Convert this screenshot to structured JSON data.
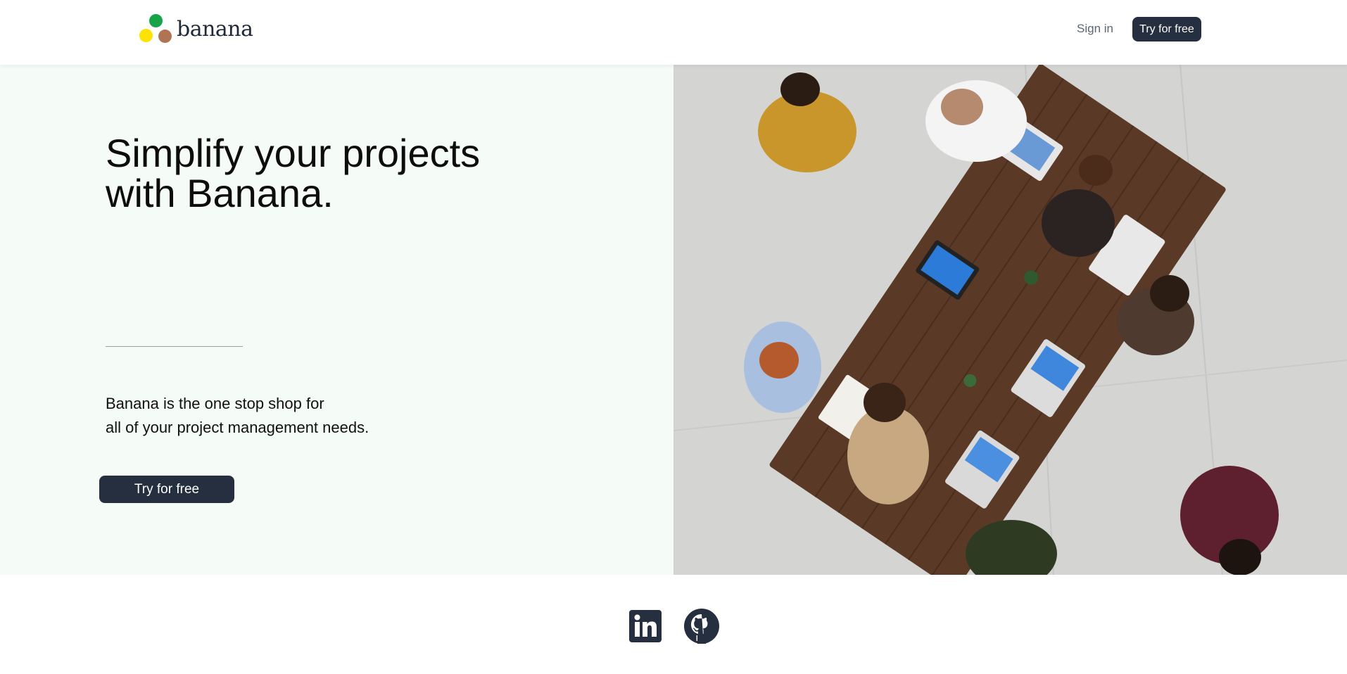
{
  "navbar": {
    "logo_text": "banana",
    "signin_label": "Sign in",
    "cta_label": "Try for free"
  },
  "hero": {
    "headline_line1": "Simplify your projects",
    "headline_line2": "with Banana.",
    "description_line1": "Banana is the one stop shop for",
    "description_line2": "all of your project management needs.",
    "cta_label": "Try for free",
    "image_subject": "team meeting around wooden table with laptops"
  },
  "footer": {
    "icons": [
      "linkedin-icon",
      "github-icon"
    ]
  },
  "colors": {
    "brand_dark": "#252f3f",
    "hero_background": "#f5fbf7",
    "logo_green": "#16a34a",
    "logo_yellow": "#fde400",
    "logo_brown": "#b07454",
    "muted_text": "#5b6675"
  }
}
